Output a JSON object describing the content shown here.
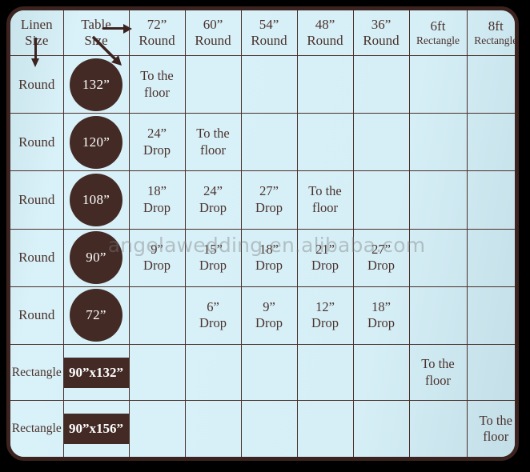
{
  "watermark": "angelawedding.en.alibaba.com",
  "header": {
    "corner_linen_label_line1": "Linen",
    "corner_linen_label_line2": "Size",
    "corner_table_label_line1": "Table",
    "corner_table_label_line2": "Size",
    "arrow_down_name": "arrow-down-icon",
    "arrow_right_name": "arrow-right-icon",
    "arrow_diagonal_name": "arrow-diagonal-icon",
    "columns": [
      {
        "line1": "72”",
        "line2": "Round",
        "kind": "round"
      },
      {
        "line1": "60”",
        "line2": "Round",
        "kind": "round"
      },
      {
        "line1": "54”",
        "line2": "Round",
        "kind": "round"
      },
      {
        "line1": "48”",
        "line2": "Round",
        "kind": "round"
      },
      {
        "line1": "36”",
        "line2": "Round",
        "kind": "round"
      },
      {
        "line1": "6ft",
        "line2": "Rectangle",
        "kind": "rect"
      },
      {
        "line1": "8ft",
        "line2": "Rectangle",
        "kind": "rect"
      }
    ]
  },
  "rows": [
    {
      "linen_shape": "Round",
      "badge": "132”",
      "badge_type": "circle",
      "cells": [
        {
          "line1": "To the",
          "line2": "floor",
          "state": "floor"
        },
        {
          "line1": "",
          "line2": "",
          "state": "empty"
        },
        {
          "line1": "",
          "line2": "",
          "state": "empty"
        },
        {
          "line1": "",
          "line2": "",
          "state": "empty"
        },
        {
          "line1": "",
          "line2": "",
          "state": "empty"
        },
        {
          "line1": "",
          "line2": "",
          "state": "empty"
        },
        {
          "line1": "",
          "line2": "",
          "state": "empty"
        }
      ]
    },
    {
      "linen_shape": "Round",
      "badge": "120”",
      "badge_type": "circle",
      "cells": [
        {
          "line1": "24”",
          "line2": "Drop",
          "state": "drop"
        },
        {
          "line1": "To the",
          "line2": "floor",
          "state": "floor"
        },
        {
          "line1": "",
          "line2": "",
          "state": "empty"
        },
        {
          "line1": "",
          "line2": "",
          "state": "empty"
        },
        {
          "line1": "",
          "line2": "",
          "state": "empty"
        },
        {
          "line1": "",
          "line2": "",
          "state": "empty"
        },
        {
          "line1": "",
          "line2": "",
          "state": "empty"
        }
      ]
    },
    {
      "linen_shape": "Round",
      "badge": "108”",
      "badge_type": "circle",
      "cells": [
        {
          "line1": "18”",
          "line2": "Drop",
          "state": "drop"
        },
        {
          "line1": "24”",
          "line2": "Drop",
          "state": "drop"
        },
        {
          "line1": "27”",
          "line2": "Drop",
          "state": "drop"
        },
        {
          "line1": "To the",
          "line2": "floor",
          "state": "floor"
        },
        {
          "line1": "",
          "line2": "",
          "state": "empty"
        },
        {
          "line1": "",
          "line2": "",
          "state": "empty"
        },
        {
          "line1": "",
          "line2": "",
          "state": "empty"
        }
      ]
    },
    {
      "linen_shape": "Round",
      "badge": "90”",
      "badge_type": "circle",
      "cells": [
        {
          "line1": "9”",
          "line2": "Drop",
          "state": "drop"
        },
        {
          "line1": "15”",
          "line2": "Drop",
          "state": "drop"
        },
        {
          "line1": "18”",
          "line2": "Drop",
          "state": "drop"
        },
        {
          "line1": "21”",
          "line2": "Drop",
          "state": "drop"
        },
        {
          "line1": "27”",
          "line2": "Drop",
          "state": "drop"
        },
        {
          "line1": "",
          "line2": "",
          "state": "empty"
        },
        {
          "line1": "",
          "line2": "",
          "state": "empty"
        }
      ]
    },
    {
      "linen_shape": "Round",
      "badge": "72”",
      "badge_type": "circle",
      "cells": [
        {
          "line1": "",
          "line2": "",
          "state": "empty"
        },
        {
          "line1": "6”",
          "line2": "Drop",
          "state": "drop"
        },
        {
          "line1": "9”",
          "line2": "Drop",
          "state": "drop"
        },
        {
          "line1": "12”",
          "line2": "Drop",
          "state": "drop"
        },
        {
          "line1": "18”",
          "line2": "Drop",
          "state": "drop"
        },
        {
          "line1": "",
          "line2": "",
          "state": "empty"
        },
        {
          "line1": "",
          "line2": "",
          "state": "empty"
        }
      ]
    },
    {
      "linen_shape": "Rectangle",
      "badge": "90”x132”",
      "badge_type": "rect",
      "cells": [
        {
          "line1": "",
          "line2": "",
          "state": "empty"
        },
        {
          "line1": "",
          "line2": "",
          "state": "empty"
        },
        {
          "line1": "",
          "line2": "",
          "state": "empty"
        },
        {
          "line1": "",
          "line2": "",
          "state": "empty"
        },
        {
          "line1": "",
          "line2": "",
          "state": "empty"
        },
        {
          "line1": "To the",
          "line2": "floor",
          "state": "floor"
        },
        {
          "line1": "",
          "line2": "",
          "state": "empty"
        }
      ]
    },
    {
      "linen_shape": "Rectangle",
      "badge": "90”x156”",
      "badge_type": "rect",
      "cells": [
        {
          "line1": "",
          "line2": "",
          "state": "empty"
        },
        {
          "line1": "",
          "line2": "",
          "state": "empty"
        },
        {
          "line1": "",
          "line2": "",
          "state": "empty"
        },
        {
          "line1": "",
          "line2": "",
          "state": "empty"
        },
        {
          "line1": "",
          "line2": "",
          "state": "empty"
        },
        {
          "line1": "",
          "line2": "",
          "state": "empty"
        },
        {
          "line1": "To the",
          "line2": "floor",
          "state": "floor"
        }
      ]
    }
  ],
  "colors": {
    "frame_border": "#3c231f",
    "cell_background": "#d6eff7",
    "floor_cell": "#dfe49a",
    "badge_fill": "#432a25",
    "badge_text": "#ffffff",
    "text": "#4a322c",
    "floor_text": "#5a4a18",
    "grid_line": "#4a2e28"
  }
}
